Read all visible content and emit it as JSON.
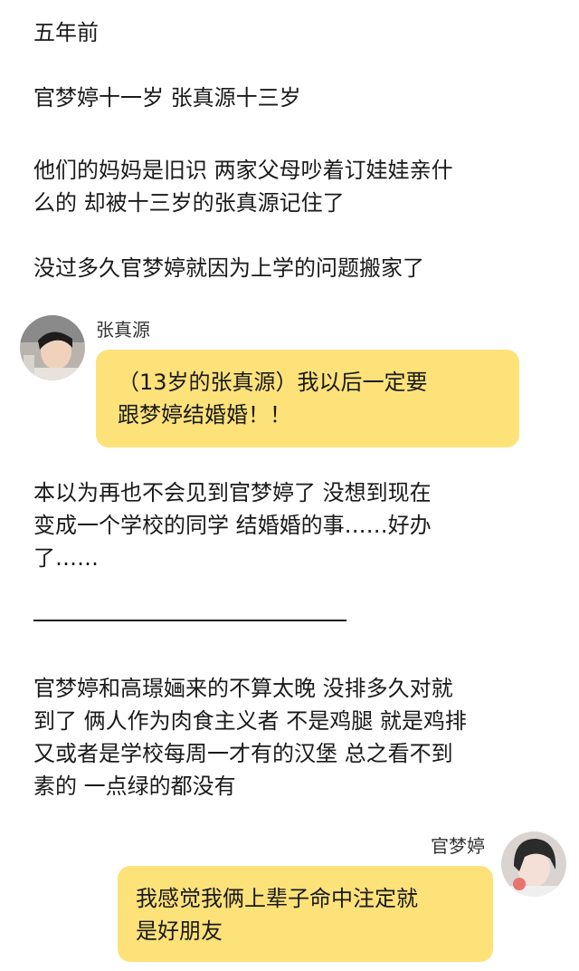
{
  "paragraphs": {
    "p1": "五年前",
    "p2": "官梦婷十一岁 张真源十三岁",
    "p3_line1": "他们的妈妈是旧识 两家父母吵着订娃娃亲什",
    "p3_line2": "么的 却被十三岁的张真源记住了",
    "p4": "没过多久官梦婷就因为上学的问题搬家了",
    "p5_line1": "本以为再也不会见到官梦婷了 没想到现在",
    "p5_line2": "变成一个学校的同学 结婚婚的事……好办",
    "p5_line3": "了……",
    "p6_line1": "官梦婷和高璟婳来的不算太晚 没排多久对就",
    "p6_line2": "到了 俩人作为肉食主义者 不是鸡腿 就是鸡排",
    "p6_line3": "又或者是学校每周一才有的汉堡 总之看不到",
    "p6_line4": "素的 一点绿的都没有"
  },
  "chat1": {
    "name": "张真源",
    "line1": "（13岁的张真源）我以后一定要",
    "line2": "跟梦婷结婚婚！！"
  },
  "chat2": {
    "name": "官梦婷",
    "line1": "我感觉我俩上辈子命中注定就",
    "line2": "是好朋友"
  }
}
